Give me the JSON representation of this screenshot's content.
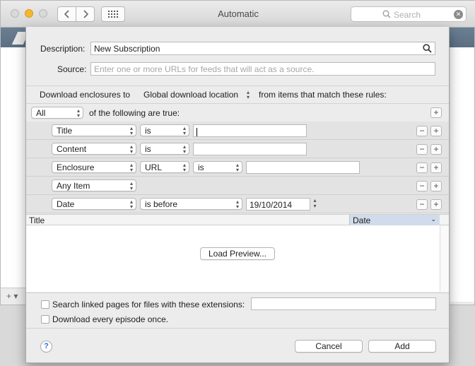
{
  "window": {
    "title": "Automatic",
    "search_placeholder": "Search",
    "bottom_add": "+ ▾"
  },
  "dialog": {
    "description_label": "Description:",
    "description_value": "New Subscription",
    "source_label": "Source:",
    "source_placeholder": "Enter one or more URLs for feeds that will act as a source.",
    "download_prefix": "Download enclosures to",
    "download_location": "Global download location",
    "download_suffix": "from items that match these rules:",
    "match_mode": "All",
    "match_suffix": "of the following are true:"
  },
  "rules": [
    {
      "field": "Title",
      "operator": "is",
      "value": ""
    },
    {
      "field": "Content",
      "operator": "is",
      "value": ""
    },
    {
      "field": "Enclosure",
      "operator": "URL",
      "operator2": "is",
      "value": ""
    },
    {
      "field": "Any Item"
    },
    {
      "field": "Date",
      "operator": "is before",
      "value": "19/10/2014"
    }
  ],
  "table": {
    "columns": [
      "Title",
      "Date"
    ],
    "load_preview": "Load Preview..."
  },
  "options": {
    "search_linked_label": "Search linked pages for files with these extensions:",
    "search_linked_checked": false,
    "search_linked_value": "",
    "download_once_label": "Download every episode once.",
    "download_once_checked": false
  },
  "buttons": {
    "help": "?",
    "cancel": "Cancel",
    "add": "Add"
  },
  "icons": {
    "back": "chevron-left-icon",
    "forward": "chevron-right-icon",
    "grid": "grid-icon",
    "search": "search-icon",
    "clear": "clear-icon"
  },
  "colors": {
    "header_strip": "#5f7387",
    "sort_column_highlight": "#d0dceb",
    "help_blue": "#2f6fd6"
  }
}
